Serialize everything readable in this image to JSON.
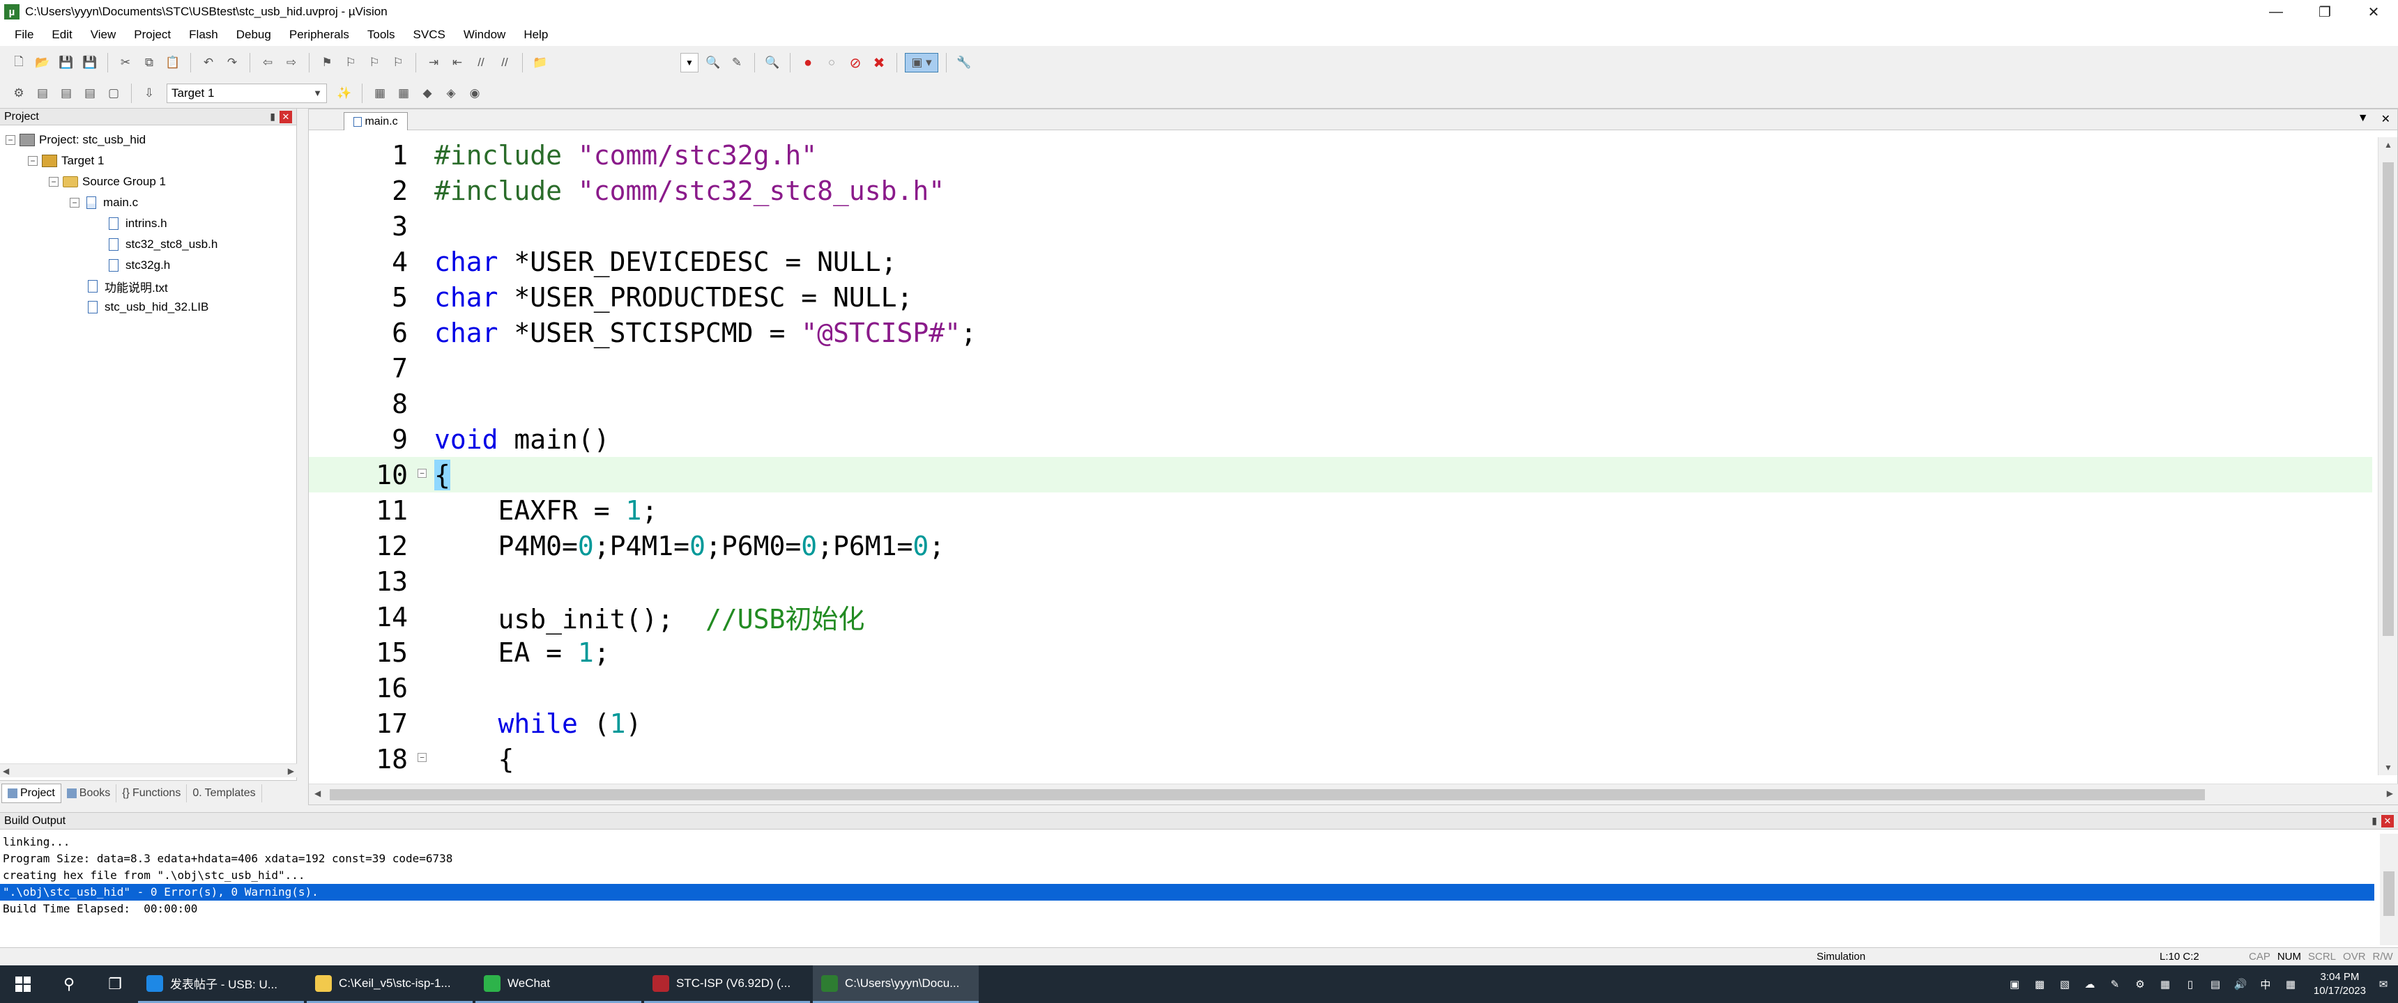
{
  "window": {
    "title": "C:\\Users\\yyyn\\Documents\\STC\\USBtest\\stc_usb_hid.uvproj - µVision",
    "app_icon": "µ"
  },
  "menubar": [
    "File",
    "Edit",
    "View",
    "Project",
    "Flash",
    "Debug",
    "Peripherals",
    "Tools",
    "SVCS",
    "Window",
    "Help"
  ],
  "toolbar": {
    "target": "Target 1"
  },
  "project_panel": {
    "title": "Project",
    "tree": {
      "project": "Project: stc_usb_hid",
      "target": "Target 1",
      "group": "Source Group 1",
      "main": "main.c",
      "includes": [
        "intrins.h",
        "stc32_stc8_usb.h",
        "stc32g.h"
      ],
      "txt": "功能说明.txt",
      "lib": "stc_usb_hid_32.LIB"
    },
    "tabs": [
      "Project",
      "Books",
      "Functions",
      "Templates"
    ]
  },
  "editor": {
    "tab": "main.c",
    "lines": [
      {
        "n": "1",
        "html": "<span class=\"pp\">#include</span> <span class=\"str\">\"comm/stc32g.h\"</span>"
      },
      {
        "n": "2",
        "html": "<span class=\"pp\">#include</span> <span class=\"str\">\"comm/stc32_stc8_usb.h\"</span>"
      },
      {
        "n": "3",
        "html": ""
      },
      {
        "n": "4",
        "html": "<span class=\"kw\">char</span> *USER_DEVICEDESC = NULL;"
      },
      {
        "n": "5",
        "html": "<span class=\"kw\">char</span> *USER_PRODUCTDESC = NULL;"
      },
      {
        "n": "6",
        "html": "<span class=\"kw\">char</span> *USER_STCISPCMD = <span class=\"str\">\"@STCISP#\"</span>;"
      },
      {
        "n": "7",
        "html": ""
      },
      {
        "n": "8",
        "html": ""
      },
      {
        "n": "9",
        "html": "<span class=\"kw\">void</span> main()"
      },
      {
        "n": "10",
        "html": "<span class=\"brace-hl\">{</span>",
        "fold": true,
        "hl": true
      },
      {
        "n": "11",
        "html": "    EAXFR = <span class=\"num\">1</span>;"
      },
      {
        "n": "12",
        "html": "    P4M0=<span class=\"num\">0</span>;P4M1=<span class=\"num\">0</span>;P6M0=<span class=\"num\">0</span>;P6M1=<span class=\"num\">0</span>;"
      },
      {
        "n": "13",
        "html": ""
      },
      {
        "n": "14",
        "html": "    usb_init();  <span class=\"cmt\">//USB初始化</span>"
      },
      {
        "n": "15",
        "html": "    EA = <span class=\"num\">1</span>;"
      },
      {
        "n": "16",
        "html": ""
      },
      {
        "n": "17",
        "html": "    <span class=\"kw\">while</span> (<span class=\"num\">1</span>)"
      },
      {
        "n": "18",
        "html": "    {",
        "fold": true
      }
    ]
  },
  "build_output": {
    "title": "Build Output",
    "lines": [
      "linking...",
      "Program Size: data=8.3 edata+hdata=406 xdata=192 const=39 code=6738",
      "creating hex file from \".\\obj\\stc_usb_hid\"...",
      "\".\\obj\\stc_usb_hid\" - 0 Error(s), 0 Warning(s).",
      "Build Time Elapsed:  00:00:00"
    ],
    "selected_index": 3
  },
  "statusbar": {
    "mode": "Simulation",
    "position": "L:10 C:2",
    "flags": [
      "CAP",
      "NUM",
      "SCRL",
      "OVR",
      "R/W"
    ]
  },
  "taskbar": {
    "items": [
      {
        "label": "发表帖子 - USB: U...",
        "color": "#1e88e5"
      },
      {
        "label": "C:\\Keil_v5\\stc-isp-1...",
        "color": "#f2c94c"
      },
      {
        "label": "WeChat",
        "color": "#2db34a"
      },
      {
        "label": "STC-ISP (V6.92D) (...",
        "color": "#b3262e"
      },
      {
        "label": "C:\\Users\\yyyn\\Docu...",
        "color": "#2e7d32"
      }
    ],
    "ime": "中",
    "time": "3:04 PM",
    "date": "10/17/2023"
  }
}
